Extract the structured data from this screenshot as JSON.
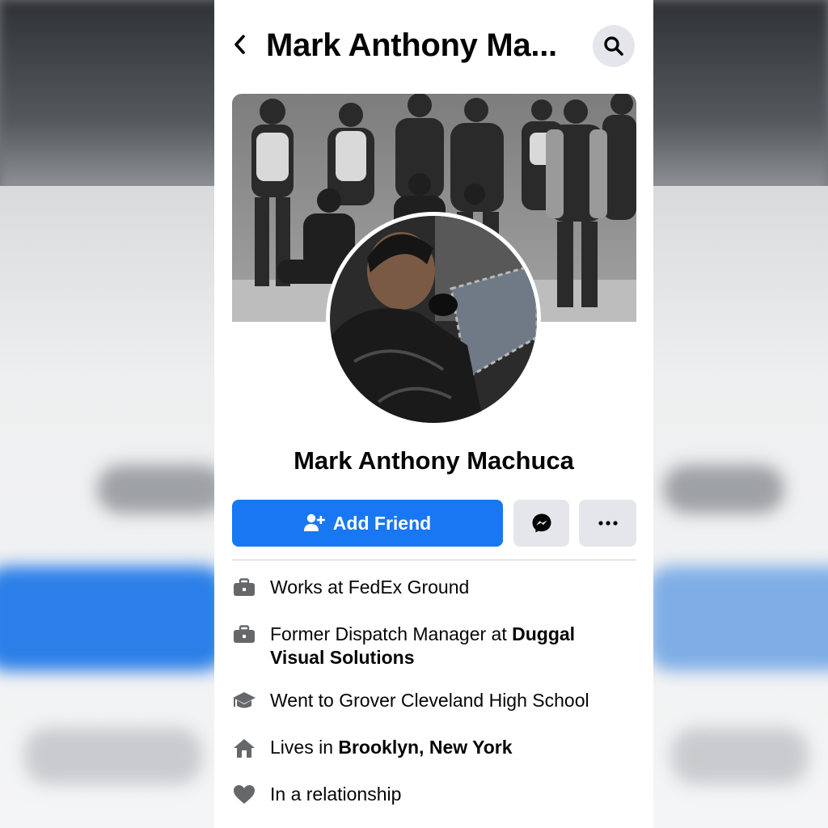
{
  "colors": {
    "accent": "#1877f2",
    "button_grey": "#e4e6eb",
    "icon_grey": "#65676b"
  },
  "header": {
    "title": "Mark Anthony Ma...",
    "back_icon": "chevron-left-icon",
    "search_icon": "search-icon"
  },
  "profile": {
    "name": "Mark Anthony Machuca",
    "cover_photo": "group-photo",
    "profile_photo": "profile-photo"
  },
  "actions": {
    "add_friend_label": "Add Friend",
    "add_friend_icon": "add-person-icon",
    "messenger_icon": "messenger-icon",
    "more_icon": "more-dots-icon"
  },
  "intro": {
    "work": {
      "prefix": "Works at FedEx Ground",
      "icon": "briefcase-icon"
    },
    "former_work": {
      "prefix": "Former Dispatch Manager at ",
      "bold": "Duggal Visual Solutions",
      "icon": "briefcase-icon"
    },
    "education": {
      "prefix": "Went to Grover Cleveland High School",
      "icon": "graduation-cap-icon"
    },
    "residence": {
      "prefix": "Lives in ",
      "bold": "Brooklyn, New York",
      "icon": "house-icon"
    },
    "relationship": {
      "prefix": "In a relationship",
      "icon": "heart-icon"
    }
  }
}
